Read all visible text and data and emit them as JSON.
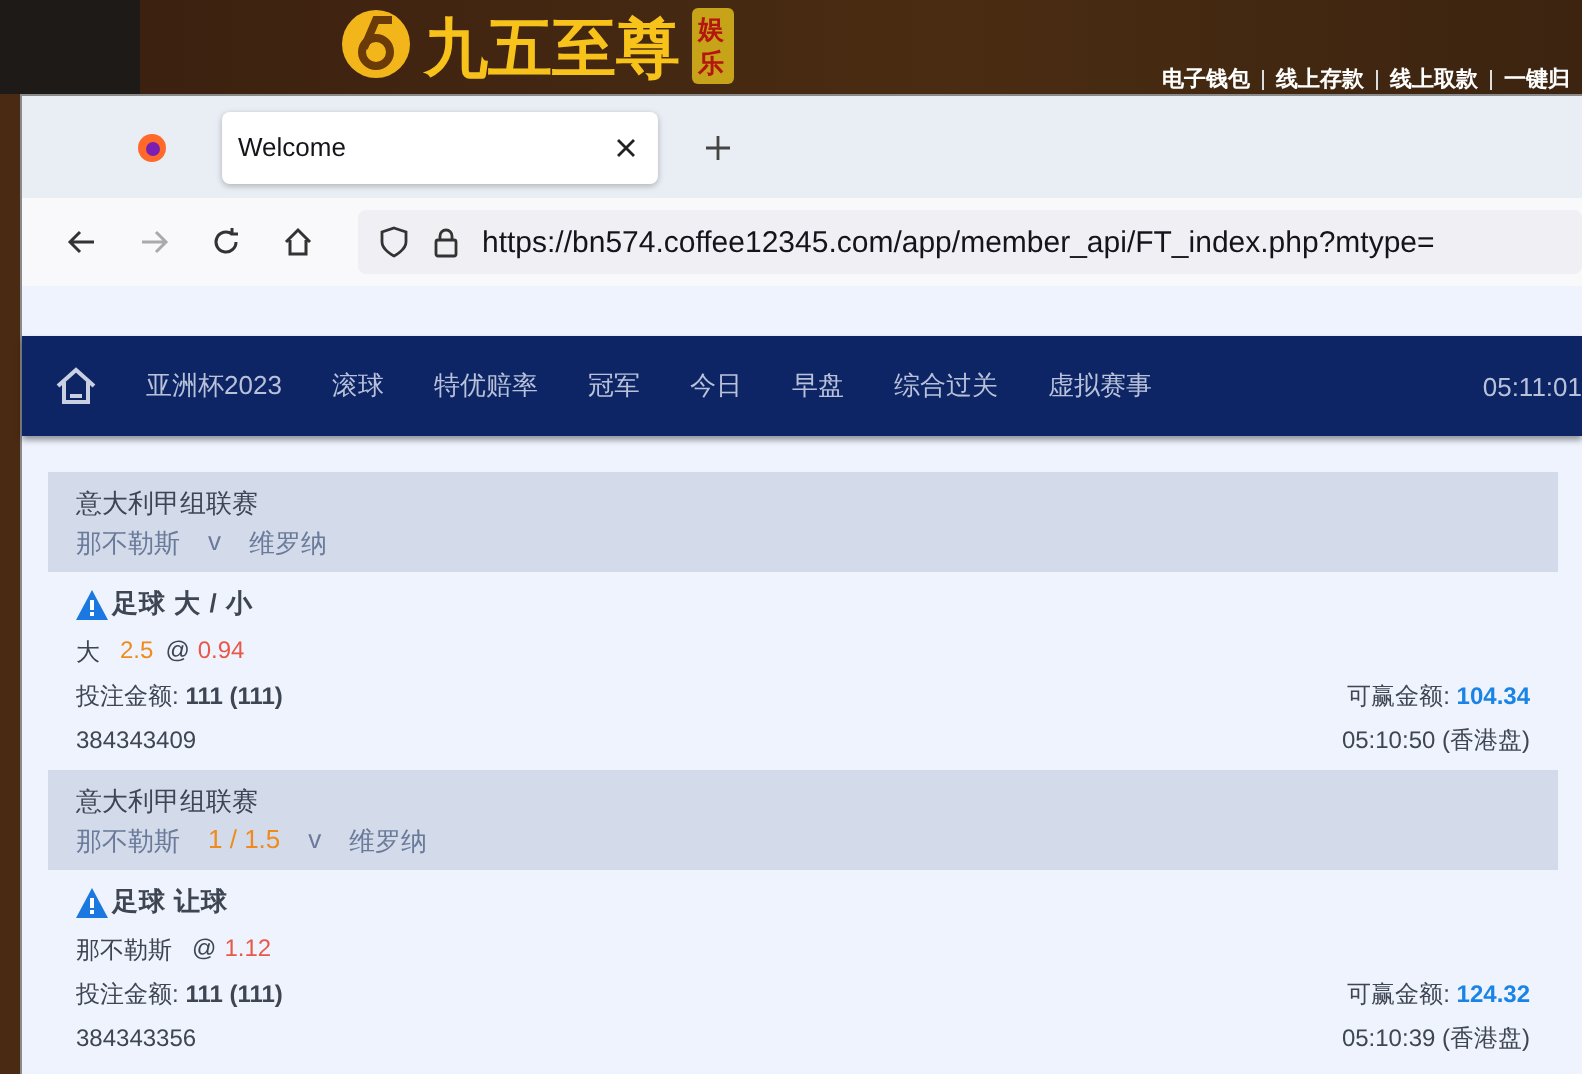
{
  "site": {
    "logo_text": "九五至尊",
    "logo_badge": "娱乐",
    "links": [
      "电子钱包",
      "线上存款",
      "线上取款",
      "一键归"
    ]
  },
  "browser": {
    "tabs": [
      {
        "title": "Welcome",
        "selected": true
      }
    ],
    "url": "https://bn574.coffee12345.com/app/member_api/FT_index.php?mtype="
  },
  "nav": {
    "items": [
      "亚洲杯2023",
      "滚球",
      "特优赔率",
      "冠军",
      "今日",
      "早盘",
      "综合过关",
      "虚拟赛事"
    ],
    "clock": "05:11:01"
  },
  "bets": [
    {
      "league": "意大利甲组联赛",
      "home": "那不勒斯",
      "vs": "v",
      "away": "维罗纳",
      "market": "足球 大 / 小",
      "selection": "大",
      "line": "2.5",
      "at": "@",
      "odds": "0.94",
      "stake_label": "投注金额:",
      "stake": "111 (111)",
      "win_label": "可赢金额:",
      "win": "104.34",
      "ticket": "384343409",
      "time": "05:10:50 (香港盘)"
    },
    {
      "league": "意大利甲组联赛",
      "home": "那不勒斯",
      "handicap": "1 / 1.5",
      "vs": "v",
      "away": "维罗纳",
      "market": "足球 让球",
      "selection": "那不勒斯",
      "at": "@",
      "odds": "1.12",
      "stake_label": "投注金额:",
      "stake": "111 (111)",
      "win_label": "可赢金额:",
      "win": "124.32",
      "ticket": "384343356",
      "time": "05:10:39 (香港盘)"
    }
  ]
}
